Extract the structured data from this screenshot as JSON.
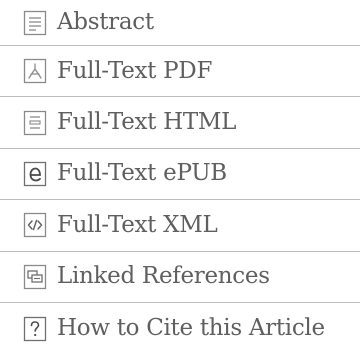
{
  "menu": {
    "items": [
      {
        "label": "Abstract",
        "icon": "document-lines-icon"
      },
      {
        "label": "Full-Text PDF",
        "icon": "pdf-icon"
      },
      {
        "label": "Full-Text HTML",
        "icon": "html-document-icon"
      },
      {
        "label": "Full-Text ePUB",
        "icon": "epub-icon"
      },
      {
        "label": "Full-Text XML",
        "icon": "xml-code-icon"
      },
      {
        "label": "Linked References",
        "icon": "linked-references-icon"
      },
      {
        "label": "How to Cite this Article",
        "icon": "question-mark-icon"
      }
    ]
  },
  "colors": {
    "text": "#5f5f5f",
    "icon": "#8a8a8a",
    "divider": "#bdbdbd"
  }
}
